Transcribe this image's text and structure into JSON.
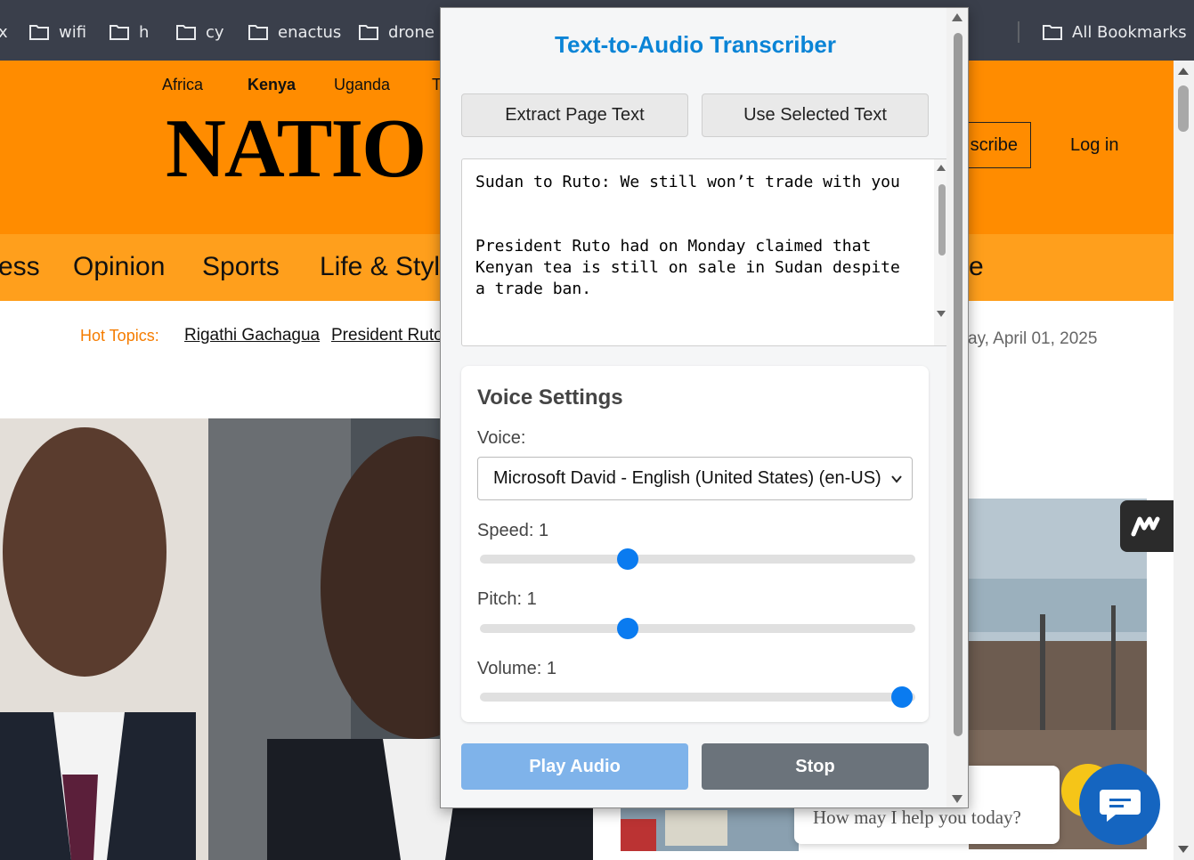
{
  "bookmarks": {
    "items": [
      {
        "label": "x"
      },
      {
        "label": "wifi"
      },
      {
        "label": "h"
      },
      {
        "label": "cy"
      },
      {
        "label": "enactus"
      },
      {
        "label": "drone"
      }
    ],
    "all_bookmarks": "All Bookmarks"
  },
  "site": {
    "top_nav": [
      "Africa",
      "Kenya",
      "Uganda",
      "T"
    ],
    "logo": "NATIO",
    "subscribe": "scribe",
    "login": "Log in",
    "nav": [
      "ess",
      "Opinion",
      "Sports",
      "Life & Style",
      "e"
    ],
    "hot_topics_label": "Hot Topics:",
    "topics": [
      "Rigathi Gachagua",
      "President Ruto"
    ],
    "date": "ay, April 01, 2025",
    "chat_prompt": "How may I help you today?"
  },
  "popup": {
    "title": "Text-to-Audio Transcriber",
    "extract_button": "Extract Page Text",
    "selected_button": "Use Selected Text",
    "text_content": "Sudan to Ruto: We still won’t trade with you\n\n\nPresident Ruto had on Monday claimed that Kenyan tea is still on sale in Sudan despite a trade ban.",
    "voice_settings": {
      "heading": "Voice Settings",
      "voice_label": "Voice:",
      "voice_value": "Microsoft David - English (United States) (en-US)",
      "speed_label": "Speed: 1",
      "speed_fraction": 0.34,
      "pitch_label": "Pitch: 1",
      "pitch_fraction": 0.34,
      "volume_label": "Volume: 1",
      "volume_fraction": 0.97
    },
    "play_button": "Play Audio",
    "stop_button": "Stop"
  },
  "colors": {
    "site_orange": "#ff8c00",
    "nav_orange": "#ff9f1c",
    "popup_title": "#0a84d6",
    "slider_thumb": "#0a7bf0",
    "play_button": "#7fb3ea",
    "stop_button": "#6b737b",
    "chat_blue": "#1565c0"
  }
}
